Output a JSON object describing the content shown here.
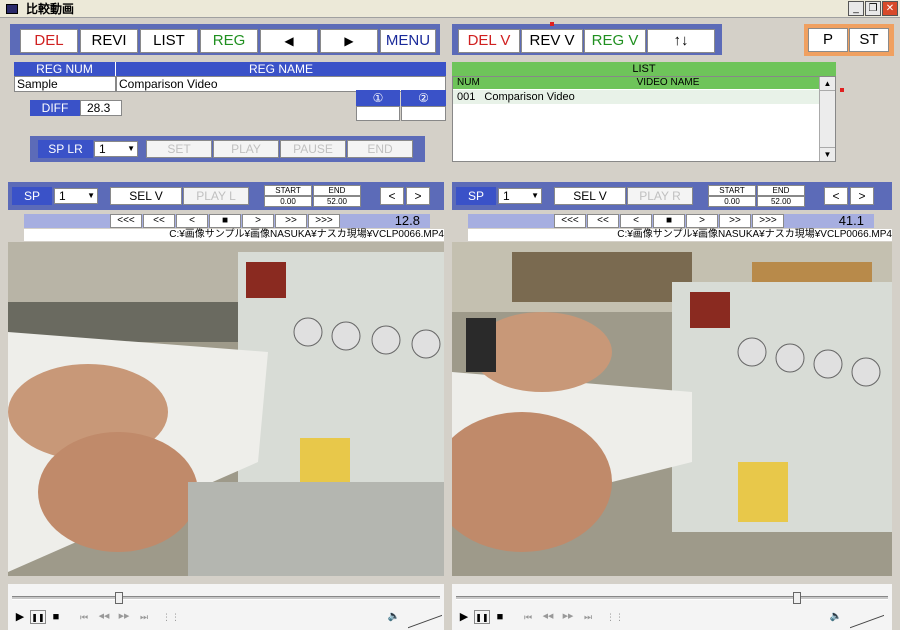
{
  "window": {
    "title": "比較動画"
  },
  "top_left": {
    "buttons": [
      "DEL",
      "REVI",
      "LIST",
      "REG",
      "◀",
      "▶",
      "MENU"
    ],
    "reg_num_header": "REG NUM",
    "reg_name_header": "REG NAME",
    "reg_num_value": "Sample",
    "reg_name_value": "Comparison Video",
    "diff_label": "DIFF",
    "diff_value": "28.3",
    "circle_1": "①",
    "circle_2": "②",
    "sp_lr_label": "SP LR",
    "sp_lr_value": "1",
    "set_label": "SET",
    "play_label": "PLAY",
    "pause_label": "PAUSE",
    "end_label": "END"
  },
  "top_right": {
    "buttons": [
      "DEL V",
      "REV V",
      "REG V",
      "↑↓"
    ],
    "p_label": "P",
    "st_label": "ST",
    "list_header": "LIST",
    "num_header": "NUM",
    "video_name_header": "VIDEO NAME",
    "list_items": [
      {
        "num": "001",
        "name": "Comparison Video"
      }
    ]
  },
  "left_player": {
    "sp_label": "SP",
    "sp_value": "1",
    "sel_label": "SEL V",
    "play_label": "PLAY L",
    "start_label": "START",
    "end_label": "END",
    "start_value": "0.00",
    "end_value": "52.00",
    "nav": [
      "<<<",
      "<<",
      "<",
      "■",
      ">",
      ">>",
      ">>>"
    ],
    "time": "12.8",
    "path": "C:¥画像サンプル¥画像NASUKA¥ナスカ現場¥VCLP0066.MP4",
    "slider_fraction": 0.25
  },
  "right_player": {
    "sp_label": "SP",
    "sp_value": "1",
    "sel_label": "SEL V",
    "play_label": "PLAY R",
    "start_label": "START",
    "end_label": "END",
    "start_value": "0.00",
    "end_value": "52.00",
    "nav": [
      "<<<",
      "<<",
      "<",
      "■",
      ">",
      ">>",
      ">>>"
    ],
    "time": "41.1",
    "path": "C:¥画像サンプル¥画像NASUKA¥ナスカ現場¥VCLP0066.MP4",
    "slider_fraction": 0.79
  },
  "icons": {
    "play": "▶",
    "pause": "❚❚",
    "stop": "■",
    "skip_back": "⏮",
    "rewind": "◀◀",
    "forward": "▶▶",
    "skip_fwd": "⏭",
    "playlist": "⋮⋮",
    "volume": "🔈"
  }
}
